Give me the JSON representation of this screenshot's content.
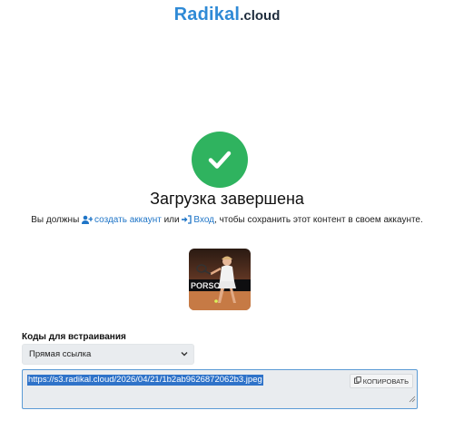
{
  "header": {
    "logo_brand": "Radikal",
    "logo_tld": ".cloud"
  },
  "status": {
    "title": "Загрузка завершена",
    "notice_prefix": "Вы должны",
    "create_account_label": "создать аккаунт",
    "or_text": "или",
    "login_label": "Вход",
    "notice_suffix": ", чтобы сохранить этот контент в своем аккаунте."
  },
  "embed": {
    "section_label": "Коды для встраивания",
    "selected_option": "Прямая ссылка",
    "code_value": "https://s3.radikal.cloud/2026/04/21/1b2ab9626872062b3.jpeg",
    "copy_label": "КОПИРОВАТЬ"
  },
  "icons": {
    "success": "check-circle-icon",
    "create_account": "user-plus-icon",
    "login": "sign-in-icon",
    "select": "chevron-down-icon",
    "copy": "copy-icon"
  },
  "colors": {
    "brand": "#2f8ad6",
    "success": "#2fb35f",
    "link": "#1f75c7"
  }
}
